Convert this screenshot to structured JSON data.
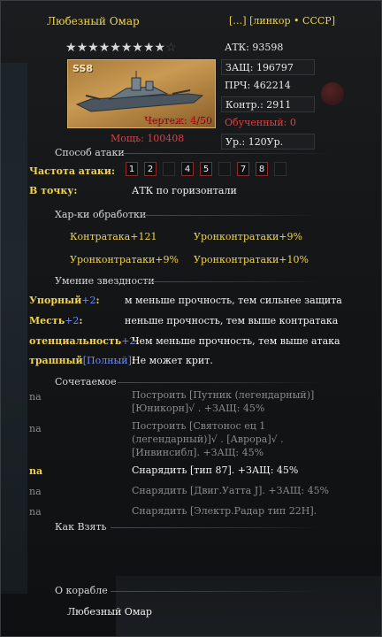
{
  "header": {
    "name": "Любезный Омар",
    "tag": "[…]  [линкор • СССР]"
  },
  "stars": {
    "filled": 9,
    "total": 10
  },
  "portrait": {
    "level": "SS8",
    "blueprint": "Чертеж: 4/50"
  },
  "power": {
    "label": "Мощь:",
    "value": "100408"
  },
  "stats": {
    "atk": "АТК: 93598",
    "def": "ЗАЩ: 196797",
    "hp": "ПРЧ: 462214",
    "counter": "Контр.: 2911",
    "trained": "Обученный: 0",
    "level": "Ур.: 120Ур."
  },
  "attack_method": {
    "title": "Способ атаки",
    "freq_label": "Частота атаки:",
    "freq_slots": [
      {
        "n": "1",
        "on": true
      },
      {
        "n": "2",
        "on": true
      },
      {
        "n": "",
        "on": false
      },
      {
        "n": "4",
        "on": true
      },
      {
        "n": "5",
        "on": true
      },
      {
        "n": "",
        "on": false
      },
      {
        "n": "7",
        "on": true
      },
      {
        "n": "8",
        "on": true
      },
      {
        "n": "",
        "on": false
      }
    ],
    "point_label": "В точку:",
    "point_value": "АТК  по горизонтали"
  },
  "processing": {
    "title": "Хар-ки обработки",
    "items": [
      "Контратака+121",
      "Уронконтратаки+9%",
      "Уронконтратаки+9%",
      "Уронконтратаки+10%"
    ]
  },
  "star_skills": {
    "title": "Умение звездности",
    "items": [
      {
        "name": "Упорный",
        "plus": "+2",
        "colon": ":",
        "desc": "м меньше прочность, тем сильнее защита"
      },
      {
        "name": "Месть",
        "plus": "+2",
        "colon": ":",
        "desc": "неньше прочность, тем выше контратака"
      },
      {
        "name": "отенциальность",
        "plus": "+2",
        "colon": ":",
        "desc": "Чем меньше прочность, тем выше атака"
      },
      {
        "name": "трашный",
        "plus": "[Полный]",
        "colon": ":",
        "desc": "Не может крит."
      }
    ]
  },
  "combos": {
    "title": "Сочетаемое",
    "rows": [
      {
        "tag": "na",
        "line1": "Построить [Путник (легендарный)]",
        "line2": "[Юникорн]√ . +ЗАЩ: 45%",
        "active": false
      },
      {
        "tag": "na",
        "line1": "Построить [Святонос ец 1",
        "line2": "(легендарный)]√ . [Аврора]√ .",
        "line3": "[Инвинсибл]. +ЗАЩ: 45%",
        "active": false
      },
      {
        "tag": "na",
        "line1": "Снарядить [тип 87]. +ЗАЩ: 45%",
        "active": true
      },
      {
        "tag": "na",
        "line1": "Снарядить [Двиг.Уатта J]. +ЗАЩ: 45%",
        "active": false
      },
      {
        "tag": "na",
        "line1": "Снарядить [Электр.Радар тип 22H].",
        "active": false
      }
    ]
  },
  "how_to_get": {
    "title": "Как Взять"
  },
  "about": {
    "title": "О корабле",
    "name": "Любезный Омар"
  },
  "colors": {
    "accent_yellow": "#f2d34a",
    "red": "#e04040",
    "green": "#3cff3c",
    "blue": "#7f9cff"
  }
}
